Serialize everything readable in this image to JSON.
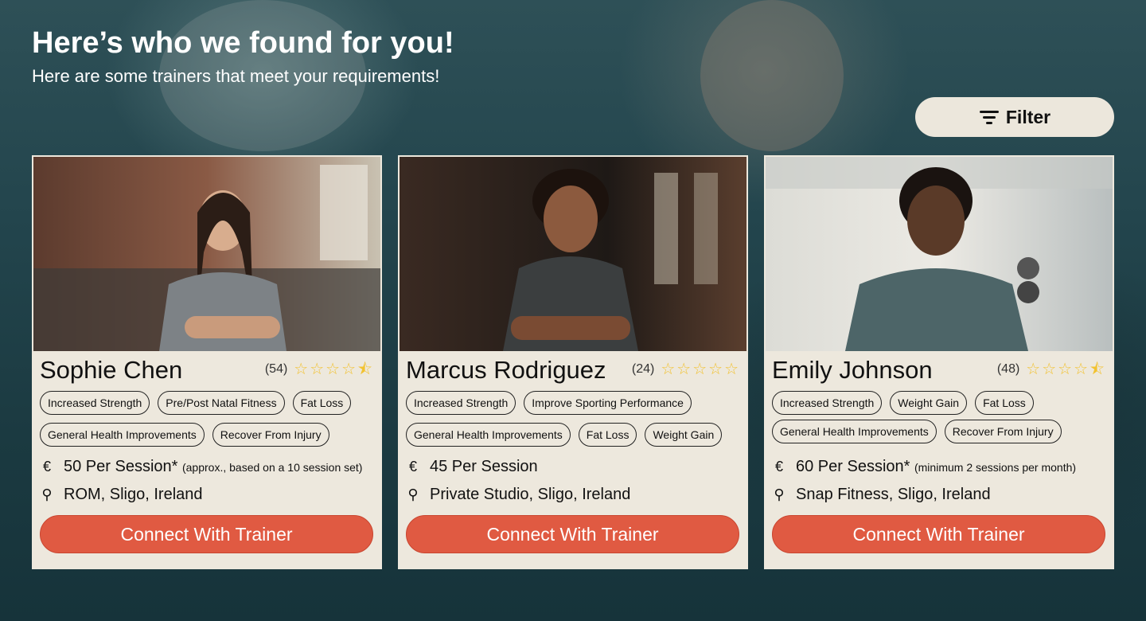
{
  "header": {
    "title": "Here’s who we found for you!",
    "subtitle": "Here are some trainers that meet your requirements!"
  },
  "filter": {
    "label": "Filter",
    "icon": "filter-icon"
  },
  "colors": {
    "accent": "#e05a42",
    "card_bg": "#ede8dd",
    "star": "#f2c230"
  },
  "trainers": [
    {
      "name": "Sophie Chen",
      "review_count": "(54)",
      "rating": 4.5,
      "tags": [
        "Increased Strength",
        "Pre/Post Natal Fitness",
        "Fat Loss",
        "General Health Improvements",
        "Recover From Injury"
      ],
      "price_symbol": "€",
      "price": "50 Per Session*",
      "price_note": "(approx., based on a 10 session set)",
      "location_icon": "location-pin-icon",
      "location": "ROM, Sligo, Ireland",
      "cta": "Connect With Trainer"
    },
    {
      "name": "Marcus Rodriguez",
      "review_count": "(24)",
      "rating": 5,
      "tags": [
        "Increased Strength",
        "Improve Sporting Performance",
        "General Health Improvements",
        "Fat Loss",
        "Weight Gain"
      ],
      "price_symbol": "€",
      "price": "45 Per Session",
      "price_note": "",
      "location_icon": "location-pin-icon",
      "location": "Private Studio, Sligo, Ireland",
      "cta": "Connect With Trainer"
    },
    {
      "name": "Emily Johnson",
      "review_count": "(48)",
      "rating": 4.5,
      "tags": [
        "Increased Strength",
        "Weight Gain",
        "Fat Loss",
        "General Health Improvements",
        "Recover From Injury"
      ],
      "price_symbol": "€",
      "price": "60 Per Session*",
      "price_note": "(minimum 2 sessions per month)",
      "location_icon": "location-pin-icon",
      "location": "Snap Fitness, Sligo, Ireland",
      "cta": "Connect With Trainer"
    }
  ]
}
